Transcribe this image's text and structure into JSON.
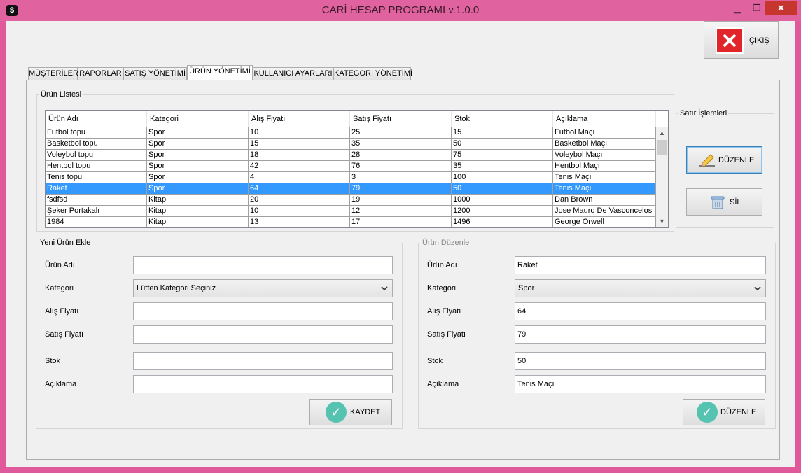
{
  "window": {
    "title": "CARİ HESAP PROGRAMI v.1.0.0",
    "app_icon": "$",
    "min": "▁",
    "max": "❐",
    "close": "✕"
  },
  "exit_button": {
    "label": "ÇIKIŞ",
    "icon": "close-x-icon"
  },
  "tabs": [
    "MÜŞTERİLER",
    "RAPORLAR",
    "SATIŞ YÖNETİMİ",
    "ÜRÜN YÖNETİMİ",
    "KULLANICI AYARLARI",
    "KATEGORİ YÖNETİMİ"
  ],
  "active_tab": "ÜRÜN YÖNETİMİ",
  "product_list": {
    "title": "Ürün Listesi",
    "columns": [
      "Ürün Adı",
      "Kategori",
      "Alış Fiyatı",
      "Satış Fiyatı",
      "Stok",
      "Açıklama"
    ],
    "rows": [
      [
        "Futbol topu",
        "Spor",
        "10",
        "25",
        "15",
        "Futbol Maçı"
      ],
      [
        "Basketbol topu",
        "Spor",
        "15",
        "35",
        "50",
        "Basketbol Maçı"
      ],
      [
        "Voleybol topu",
        "Spor",
        "18",
        "28",
        "75",
        "Voleybol Maçı"
      ],
      [
        "Hentbol topu",
        "Spor",
        "42",
        "76",
        "35",
        "Hentbol Maçı"
      ],
      [
        "Tenis topu",
        "Spor",
        "4",
        "3",
        "100",
        "Tenis Maçı"
      ],
      [
        "Raket",
        "Spor",
        "64",
        "79",
        "50",
        "Tenis Maçı"
      ],
      [
        "fsdfsd",
        "Kitap",
        "20",
        "19",
        "1000",
        "Dan Brown"
      ],
      [
        "Şeker Portakalı",
        "Kitap",
        "10",
        "12",
        "1200",
        "Jose Mauro De Vasconcelos"
      ],
      [
        "1984",
        "Kitap",
        "13",
        "17",
        "1496",
        "George Orwell"
      ]
    ],
    "selected_row": 5,
    "scroll_up": "▲",
    "scroll_down": "▼"
  },
  "row_ops": {
    "title": "Satır İşlemleri",
    "edit_label": "DÜZENLE",
    "delete_label": "SİL"
  },
  "new_product": {
    "title": "Yeni Ürün Ekle",
    "labels": {
      "name": "Ürün Adı",
      "category": "Kategori",
      "buy": "Alış Fiyatı",
      "sell": "Satış Fiyatı",
      "stock": "Stok",
      "desc": "Açıklama"
    },
    "values": {
      "name": "",
      "category": "Lütfen Kategori Seçiniz",
      "buy": "",
      "sell": "",
      "stock": "",
      "desc": ""
    },
    "save_label": "KAYDET"
  },
  "edit_product": {
    "title": "Ürün Düzenle",
    "labels": {
      "name": "Ürün Adı",
      "category": "Kategori",
      "buy": "Alış Fiyatı",
      "sell": "Satış Fiyatı",
      "stock": "Stok",
      "desc": "Açıklama"
    },
    "values": {
      "name": "Raket",
      "category": "Spor",
      "buy": "64",
      "sell": "79",
      "stock": "50",
      "desc": "Tenis Maçı"
    },
    "save_label": "DÜZENLE"
  },
  "icons": {
    "check": "✓",
    "chevron": "⌄",
    "close": "✕"
  }
}
